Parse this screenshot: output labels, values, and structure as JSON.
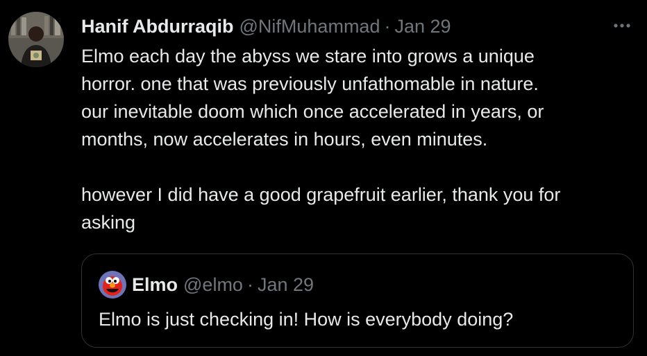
{
  "tweet": {
    "author_name": "Hanif Abdurraqib",
    "author_handle": "@NifMuhammad",
    "separator": "·",
    "date": "Jan 29",
    "text": "Elmo each day the abyss we stare into grows a unique\nhorror. one that was previously unfathomable in nature.\nour inevitable doom which once accelerated in years, or\nmonths, now accelerates in hours, even minutes.\n\nhowever I did have a good grapefruit earlier, thank you for\nasking",
    "more_icon": "more-horizontal-icon"
  },
  "quoted_tweet": {
    "author_name": "Elmo",
    "author_handle": "@elmo",
    "separator": "·",
    "date": "Jan 29",
    "text": "Elmo is just checking in! How is everybody doing?"
  },
  "colors": {
    "background": "#000000",
    "primary_text": "#e7e9ea",
    "secondary_text": "#71767b",
    "border": "#2f3336",
    "elmo_red": "#e0241b"
  }
}
